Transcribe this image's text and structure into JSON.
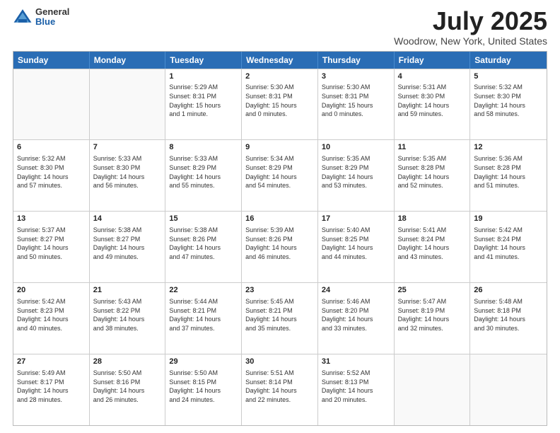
{
  "logo": {
    "general": "General",
    "blue": "Blue"
  },
  "title": "July 2025",
  "subtitle": "Woodrow, New York, United States",
  "header_days": [
    "Sunday",
    "Monday",
    "Tuesday",
    "Wednesday",
    "Thursday",
    "Friday",
    "Saturday"
  ],
  "weeks": [
    [
      {
        "day": "",
        "info": ""
      },
      {
        "day": "",
        "info": ""
      },
      {
        "day": "1",
        "info": "Sunrise: 5:29 AM\nSunset: 8:31 PM\nDaylight: 15 hours\nand 1 minute."
      },
      {
        "day": "2",
        "info": "Sunrise: 5:30 AM\nSunset: 8:31 PM\nDaylight: 15 hours\nand 0 minutes."
      },
      {
        "day": "3",
        "info": "Sunrise: 5:30 AM\nSunset: 8:31 PM\nDaylight: 15 hours\nand 0 minutes."
      },
      {
        "day": "4",
        "info": "Sunrise: 5:31 AM\nSunset: 8:30 PM\nDaylight: 14 hours\nand 59 minutes."
      },
      {
        "day": "5",
        "info": "Sunrise: 5:32 AM\nSunset: 8:30 PM\nDaylight: 14 hours\nand 58 minutes."
      }
    ],
    [
      {
        "day": "6",
        "info": "Sunrise: 5:32 AM\nSunset: 8:30 PM\nDaylight: 14 hours\nand 57 minutes."
      },
      {
        "day": "7",
        "info": "Sunrise: 5:33 AM\nSunset: 8:30 PM\nDaylight: 14 hours\nand 56 minutes."
      },
      {
        "day": "8",
        "info": "Sunrise: 5:33 AM\nSunset: 8:29 PM\nDaylight: 14 hours\nand 55 minutes."
      },
      {
        "day": "9",
        "info": "Sunrise: 5:34 AM\nSunset: 8:29 PM\nDaylight: 14 hours\nand 54 minutes."
      },
      {
        "day": "10",
        "info": "Sunrise: 5:35 AM\nSunset: 8:29 PM\nDaylight: 14 hours\nand 53 minutes."
      },
      {
        "day": "11",
        "info": "Sunrise: 5:35 AM\nSunset: 8:28 PM\nDaylight: 14 hours\nand 52 minutes."
      },
      {
        "day": "12",
        "info": "Sunrise: 5:36 AM\nSunset: 8:28 PM\nDaylight: 14 hours\nand 51 minutes."
      }
    ],
    [
      {
        "day": "13",
        "info": "Sunrise: 5:37 AM\nSunset: 8:27 PM\nDaylight: 14 hours\nand 50 minutes."
      },
      {
        "day": "14",
        "info": "Sunrise: 5:38 AM\nSunset: 8:27 PM\nDaylight: 14 hours\nand 49 minutes."
      },
      {
        "day": "15",
        "info": "Sunrise: 5:38 AM\nSunset: 8:26 PM\nDaylight: 14 hours\nand 47 minutes."
      },
      {
        "day": "16",
        "info": "Sunrise: 5:39 AM\nSunset: 8:26 PM\nDaylight: 14 hours\nand 46 minutes."
      },
      {
        "day": "17",
        "info": "Sunrise: 5:40 AM\nSunset: 8:25 PM\nDaylight: 14 hours\nand 44 minutes."
      },
      {
        "day": "18",
        "info": "Sunrise: 5:41 AM\nSunset: 8:24 PM\nDaylight: 14 hours\nand 43 minutes."
      },
      {
        "day": "19",
        "info": "Sunrise: 5:42 AM\nSunset: 8:24 PM\nDaylight: 14 hours\nand 41 minutes."
      }
    ],
    [
      {
        "day": "20",
        "info": "Sunrise: 5:42 AM\nSunset: 8:23 PM\nDaylight: 14 hours\nand 40 minutes."
      },
      {
        "day": "21",
        "info": "Sunrise: 5:43 AM\nSunset: 8:22 PM\nDaylight: 14 hours\nand 38 minutes."
      },
      {
        "day": "22",
        "info": "Sunrise: 5:44 AM\nSunset: 8:21 PM\nDaylight: 14 hours\nand 37 minutes."
      },
      {
        "day": "23",
        "info": "Sunrise: 5:45 AM\nSunset: 8:21 PM\nDaylight: 14 hours\nand 35 minutes."
      },
      {
        "day": "24",
        "info": "Sunrise: 5:46 AM\nSunset: 8:20 PM\nDaylight: 14 hours\nand 33 minutes."
      },
      {
        "day": "25",
        "info": "Sunrise: 5:47 AM\nSunset: 8:19 PM\nDaylight: 14 hours\nand 32 minutes."
      },
      {
        "day": "26",
        "info": "Sunrise: 5:48 AM\nSunset: 8:18 PM\nDaylight: 14 hours\nand 30 minutes."
      }
    ],
    [
      {
        "day": "27",
        "info": "Sunrise: 5:49 AM\nSunset: 8:17 PM\nDaylight: 14 hours\nand 28 minutes."
      },
      {
        "day": "28",
        "info": "Sunrise: 5:50 AM\nSunset: 8:16 PM\nDaylight: 14 hours\nand 26 minutes."
      },
      {
        "day": "29",
        "info": "Sunrise: 5:50 AM\nSunset: 8:15 PM\nDaylight: 14 hours\nand 24 minutes."
      },
      {
        "day": "30",
        "info": "Sunrise: 5:51 AM\nSunset: 8:14 PM\nDaylight: 14 hours\nand 22 minutes."
      },
      {
        "day": "31",
        "info": "Sunrise: 5:52 AM\nSunset: 8:13 PM\nDaylight: 14 hours\nand 20 minutes."
      },
      {
        "day": "",
        "info": ""
      },
      {
        "day": "",
        "info": ""
      }
    ]
  ]
}
